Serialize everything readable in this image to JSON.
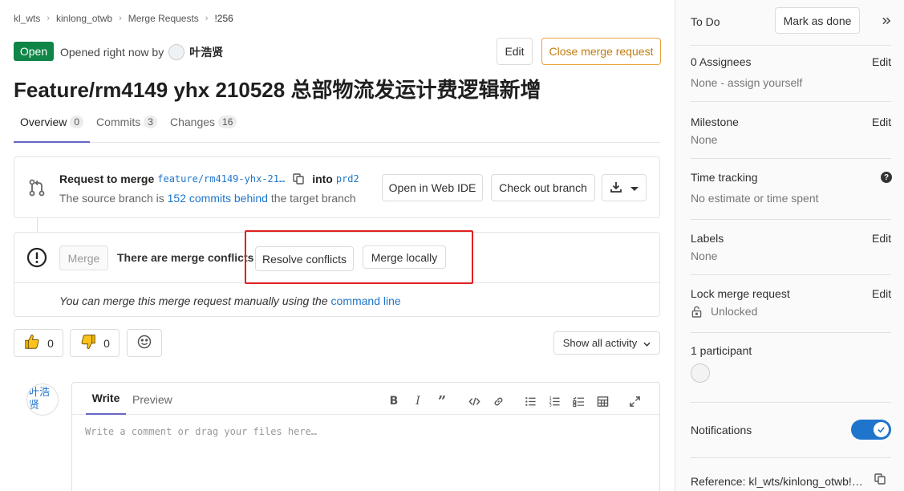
{
  "breadcrumb": {
    "items": [
      "kl_wts",
      "kinlong_otwb",
      "Merge Requests",
      "!256"
    ]
  },
  "mr": {
    "status": "Open",
    "opened_text": "Opened right now by",
    "author": "叶浩贤",
    "edit_label": "Edit",
    "close_label": "Close merge request",
    "title": "Feature/rm4149 yhx 210528 总部物流发运计费逻辑新增"
  },
  "tabs": [
    {
      "label": "Overview",
      "count": "0"
    },
    {
      "label": "Commits",
      "count": "3"
    },
    {
      "label": "Changes",
      "count": "16"
    }
  ],
  "request": {
    "prefix": "Request to merge",
    "source": "feature/rm4149-yhx-21…",
    "into": "into",
    "target": "prd2",
    "behind_pre": "The source branch is",
    "behind_link": "152 commits behind",
    "behind_post": "the target branch",
    "web_ide": "Open in Web IDE",
    "checkout": "Check out branch"
  },
  "merge": {
    "merge_label": "Merge",
    "conflicts_text": "There are merge conflicts",
    "resolve_label": "Resolve conflicts",
    "local_label": "Merge locally",
    "manual_text": "You can merge this merge request manually using the",
    "manual_link": "command line"
  },
  "reactions": {
    "thumbs_up": "0",
    "thumbs_down": "0"
  },
  "activity_label": "Show all activity",
  "comment": {
    "avatar_alt": "叶浩贤",
    "write_tab": "Write",
    "preview_tab": "Preview",
    "placeholder": "Write a comment or drag your files here…"
  },
  "sidebar": {
    "todo": "To Do",
    "mark_done": "Mark as done",
    "assignees_label": "0 Assignees",
    "assignees_value": "None - assign yourself",
    "milestone_label": "Milestone",
    "milestone_value": "None",
    "time_label": "Time tracking",
    "time_value": "No estimate or time spent",
    "labels_label": "Labels",
    "labels_value": "None",
    "lock_label": "Lock merge request",
    "lock_value": "Unlocked",
    "participants_label": "1 participant",
    "notifications_label": "Notifications",
    "reference_label": "Reference: kl_wts/kinlong_otwb!…",
    "edit": "Edit"
  },
  "colors": {
    "accent": "#1f75cb",
    "open_badge": "#108548",
    "close_border": "#e9a43b",
    "highlight": "#e02020"
  }
}
